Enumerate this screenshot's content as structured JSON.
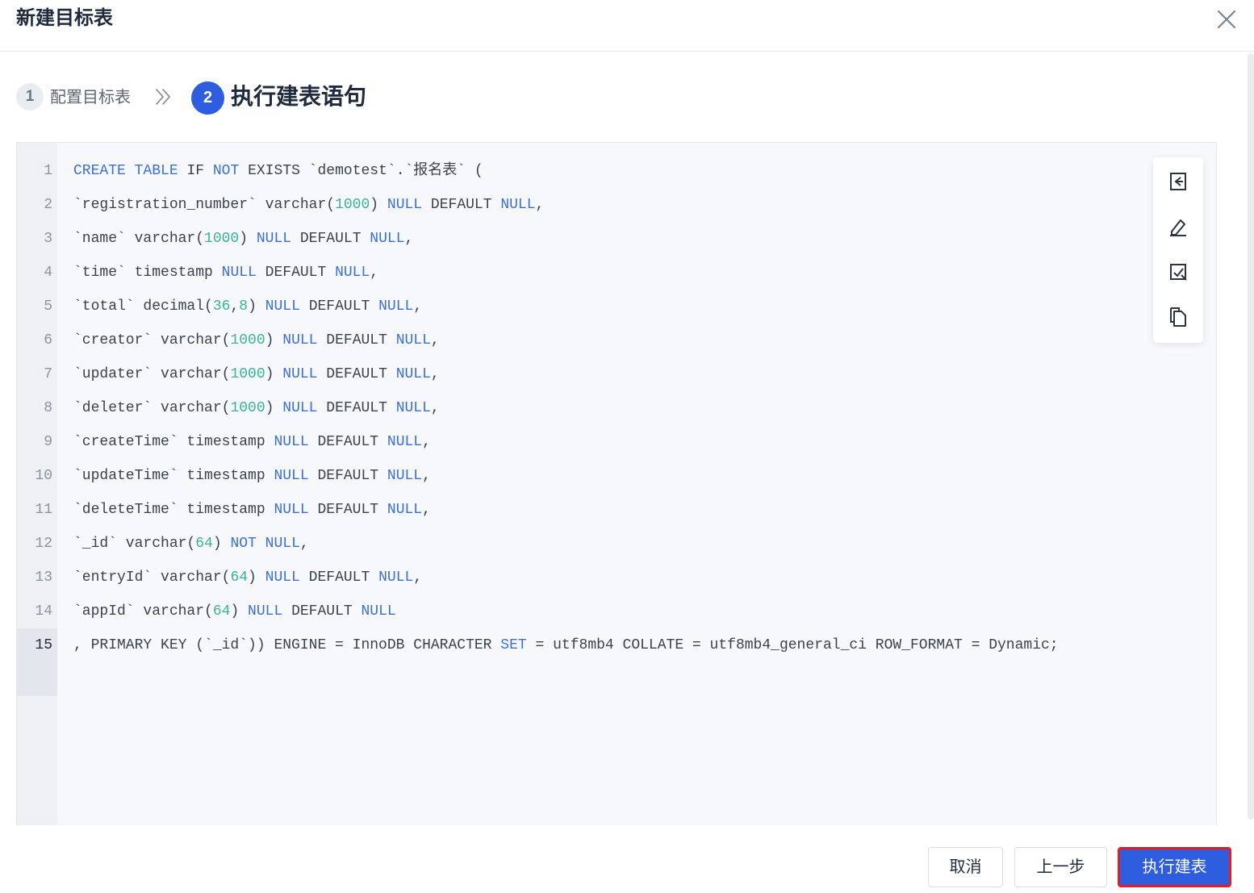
{
  "dialog": {
    "title": "新建目标表"
  },
  "steps": [
    {
      "num": "1",
      "label": "配置目标表"
    },
    {
      "num": "2",
      "label": "执行建表语句"
    }
  ],
  "editor": {
    "line_numbers": [
      "1",
      "2",
      "3",
      "4",
      "5",
      "6",
      "7",
      "8",
      "9",
      "10",
      "11",
      "12",
      "13",
      "14",
      "15"
    ],
    "active_line": "15",
    "lines": [
      [
        [
          "kw",
          "CREATE"
        ],
        [
          "t",
          " "
        ],
        [
          "kw",
          "TABLE"
        ],
        [
          "t",
          " IF "
        ],
        [
          "kw",
          "NOT"
        ],
        [
          "t",
          " EXISTS `demotest`.`报名表` ("
        ]
      ],
      [
        [
          "t",
          "`registration_number` varchar("
        ],
        [
          "num",
          "1000"
        ],
        [
          "t",
          ") "
        ],
        [
          "kw",
          "NULL"
        ],
        [
          "t",
          " DEFAULT "
        ],
        [
          "kw",
          "NULL"
        ],
        [
          "t",
          ","
        ]
      ],
      [
        [
          "t",
          "`name` varchar("
        ],
        [
          "num",
          "1000"
        ],
        [
          "t",
          ") "
        ],
        [
          "kw",
          "NULL"
        ],
        [
          "t",
          " DEFAULT "
        ],
        [
          "kw",
          "NULL"
        ],
        [
          "t",
          ","
        ]
      ],
      [
        [
          "t",
          "`time` timestamp "
        ],
        [
          "kw",
          "NULL"
        ],
        [
          "t",
          " DEFAULT "
        ],
        [
          "kw",
          "NULL"
        ],
        [
          "t",
          ","
        ]
      ],
      [
        [
          "t",
          "`total` decimal("
        ],
        [
          "num",
          "36"
        ],
        [
          "t",
          ","
        ],
        [
          "num",
          "8"
        ],
        [
          "t",
          ") "
        ],
        [
          "kw",
          "NULL"
        ],
        [
          "t",
          " DEFAULT "
        ],
        [
          "kw",
          "NULL"
        ],
        [
          "t",
          ","
        ]
      ],
      [
        [
          "t",
          "`creator` varchar("
        ],
        [
          "num",
          "1000"
        ],
        [
          "t",
          ") "
        ],
        [
          "kw",
          "NULL"
        ],
        [
          "t",
          " DEFAULT "
        ],
        [
          "kw",
          "NULL"
        ],
        [
          "t",
          ","
        ]
      ],
      [
        [
          "t",
          "`updater` varchar("
        ],
        [
          "num",
          "1000"
        ],
        [
          "t",
          ") "
        ],
        [
          "kw",
          "NULL"
        ],
        [
          "t",
          " DEFAULT "
        ],
        [
          "kw",
          "NULL"
        ],
        [
          "t",
          ","
        ]
      ],
      [
        [
          "t",
          "`deleter` varchar("
        ],
        [
          "num",
          "1000"
        ],
        [
          "t",
          ") "
        ],
        [
          "kw",
          "NULL"
        ],
        [
          "t",
          " DEFAULT "
        ],
        [
          "kw",
          "NULL"
        ],
        [
          "t",
          ","
        ]
      ],
      [
        [
          "t",
          "`createTime` timestamp "
        ],
        [
          "kw",
          "NULL"
        ],
        [
          "t",
          " DEFAULT "
        ],
        [
          "kw",
          "NULL"
        ],
        [
          "t",
          ","
        ]
      ],
      [
        [
          "t",
          "`updateTime` timestamp "
        ],
        [
          "kw",
          "NULL"
        ],
        [
          "t",
          " DEFAULT "
        ],
        [
          "kw",
          "NULL"
        ],
        [
          "t",
          ","
        ]
      ],
      [
        [
          "t",
          "`deleteTime` timestamp "
        ],
        [
          "kw",
          "NULL"
        ],
        [
          "t",
          " DEFAULT "
        ],
        [
          "kw",
          "NULL"
        ],
        [
          "t",
          ","
        ]
      ],
      [
        [
          "t",
          "`_id` varchar("
        ],
        [
          "num",
          "64"
        ],
        [
          "t",
          ") "
        ],
        [
          "kw",
          "NOT"
        ],
        [
          "t",
          " "
        ],
        [
          "kw",
          "NULL"
        ],
        [
          "t",
          ","
        ]
      ],
      [
        [
          "t",
          "`entryId` varchar("
        ],
        [
          "num",
          "64"
        ],
        [
          "t",
          ") "
        ],
        [
          "kw",
          "NULL"
        ],
        [
          "t",
          " DEFAULT "
        ],
        [
          "kw",
          "NULL"
        ],
        [
          "t",
          ","
        ]
      ],
      [
        [
          "t",
          "`appId` varchar("
        ],
        [
          "num",
          "64"
        ],
        [
          "t",
          ") "
        ],
        [
          "kw",
          "NULL"
        ],
        [
          "t",
          " DEFAULT "
        ],
        [
          "kw",
          "NULL"
        ]
      ],
      [
        [
          "t",
          ", PRIMARY KEY (`_id`)) ENGINE = InnoDB CHARACTER "
        ],
        [
          "kw",
          "SET"
        ],
        [
          "t",
          " = utf8mb4 COLLATE = utf8mb4_general_ci ROW_FORMAT = Dynamic;"
        ]
      ]
    ],
    "toolbar": [
      {
        "name": "format-icon",
        "title": ""
      },
      {
        "name": "edit-icon",
        "title": ""
      },
      {
        "name": "check-icon",
        "title": ""
      },
      {
        "name": "copy-icon",
        "title": ""
      }
    ]
  },
  "footer": {
    "cancel_label": "取消",
    "prev_label": "上一步",
    "exec_label": "执行建表"
  },
  "colors": {
    "primary": "#2f5de0",
    "keyword": "#3b6fd8",
    "number": "#3ab39a",
    "highlight_border": "#e02020"
  }
}
